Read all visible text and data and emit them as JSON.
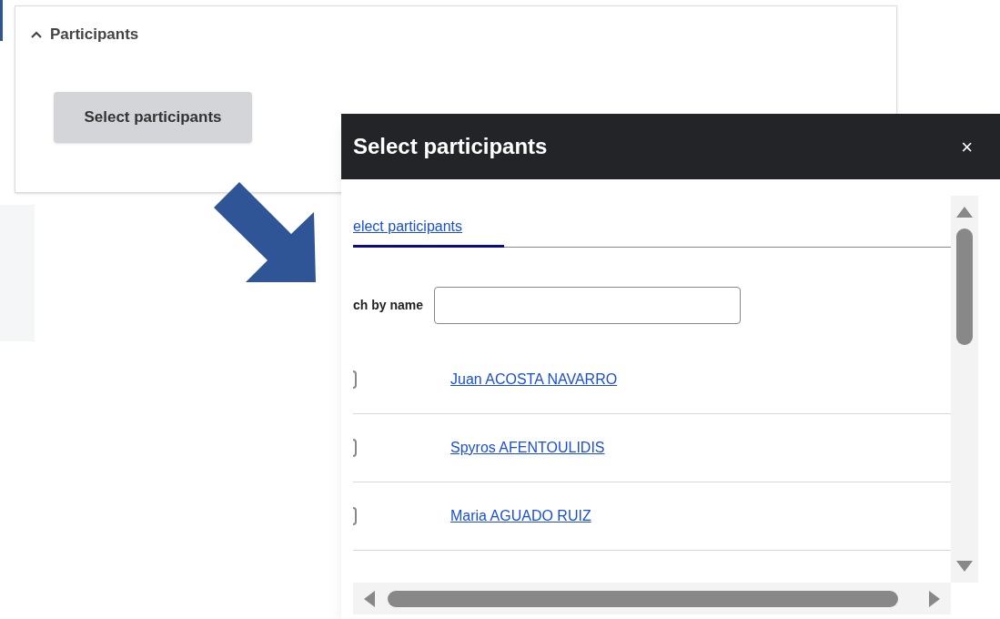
{
  "panel": {
    "title": "Participants",
    "expanded": true,
    "button": "Select participants"
  },
  "dialog": {
    "title": "Select participants",
    "close": "×",
    "tabs": [
      {
        "label": "elect participants",
        "selected": true
      }
    ],
    "search": {
      "label": "ch by name"
    },
    "participants": [
      {
        "name": "Juan ACOSTA NAVARRO",
        "checked": false
      },
      {
        "name": "Spyros AFENTOULIDIS",
        "checked": false
      },
      {
        "name": "Maria AGUADO RUIZ",
        "checked": false
      }
    ]
  }
}
